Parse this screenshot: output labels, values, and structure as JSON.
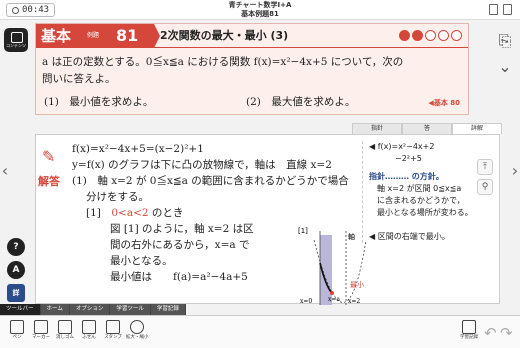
{
  "header": {
    "timer": "00:43",
    "title_line1": "青チャート数学Ⅰ+A",
    "title_line2": "基本例題81"
  },
  "sidebar": {
    "content_label": "コンテンツ",
    "tools": [
      "?",
      "A",
      "詳"
    ]
  },
  "problem": {
    "label_kihon": "基本",
    "label_reidai": "例題",
    "number": "81",
    "title": "2次関数の最大・最小 (3)",
    "difficulty": 2,
    "text_line1": "a は正の定数とする。0≦x≦a における関数 f(x)=x²−4x+5 について，次の",
    "text_line2": "問いに答えよ。",
    "sub1": "(1)　最小値を求めよ。",
    "sub2": "(2)　最大値を求めよ。",
    "ref": "基本 80"
  },
  "tabs": [
    "指針",
    "答",
    "詳解"
  ],
  "answer": {
    "label": "解答",
    "l1": "f(x)=x²−4x+5=(x−2)²+1",
    "l2": "y=f(x) のグラフは下に凸の放物線で，軸は　直線 x=2",
    "l3": "(1)　軸 x=2 が 0≦x≦a の範囲に含まれるかどうかで場合",
    "l4": "分けをする。",
    "l5a": "[1]　",
    "l5b": "0<a<2",
    "l5c": " のとき",
    "l6": "図 [1] のように，軸 x=2 は区",
    "l7": "間の右外にあるから，x=a で",
    "l8": "最小となる。",
    "l9": "最小値は　　f(a)=a²−4a+5",
    "graph_label": "[1]",
    "graph_axis": "軸",
    "graph_min": "最小",
    "graph_x0": "x=0",
    "graph_xa": "x=a",
    "graph_x2": "x=2"
  },
  "hints": {
    "h1": "◀ f(x)=x²−4x+2",
    "h1b": "−2²+5",
    "h2": "指針……… の方針。",
    "h3": "軸 x=2 が区間 0≦x≦a",
    "h4": "に含まれるかどうかで，",
    "h5": "最小となる場所が変わる。",
    "h6": "◀ 区間の右端で最小。"
  },
  "toolbar": {
    "tabs": [
      "ツールバー",
      "ホーム",
      "オプション",
      "学習ツール",
      "学習記録"
    ],
    "tools": [
      "ペン",
      "マーカー",
      "消しゴム",
      "ふせん",
      "スタンプ",
      "拡大・縮小"
    ],
    "right_tool": "学習記録"
  }
}
